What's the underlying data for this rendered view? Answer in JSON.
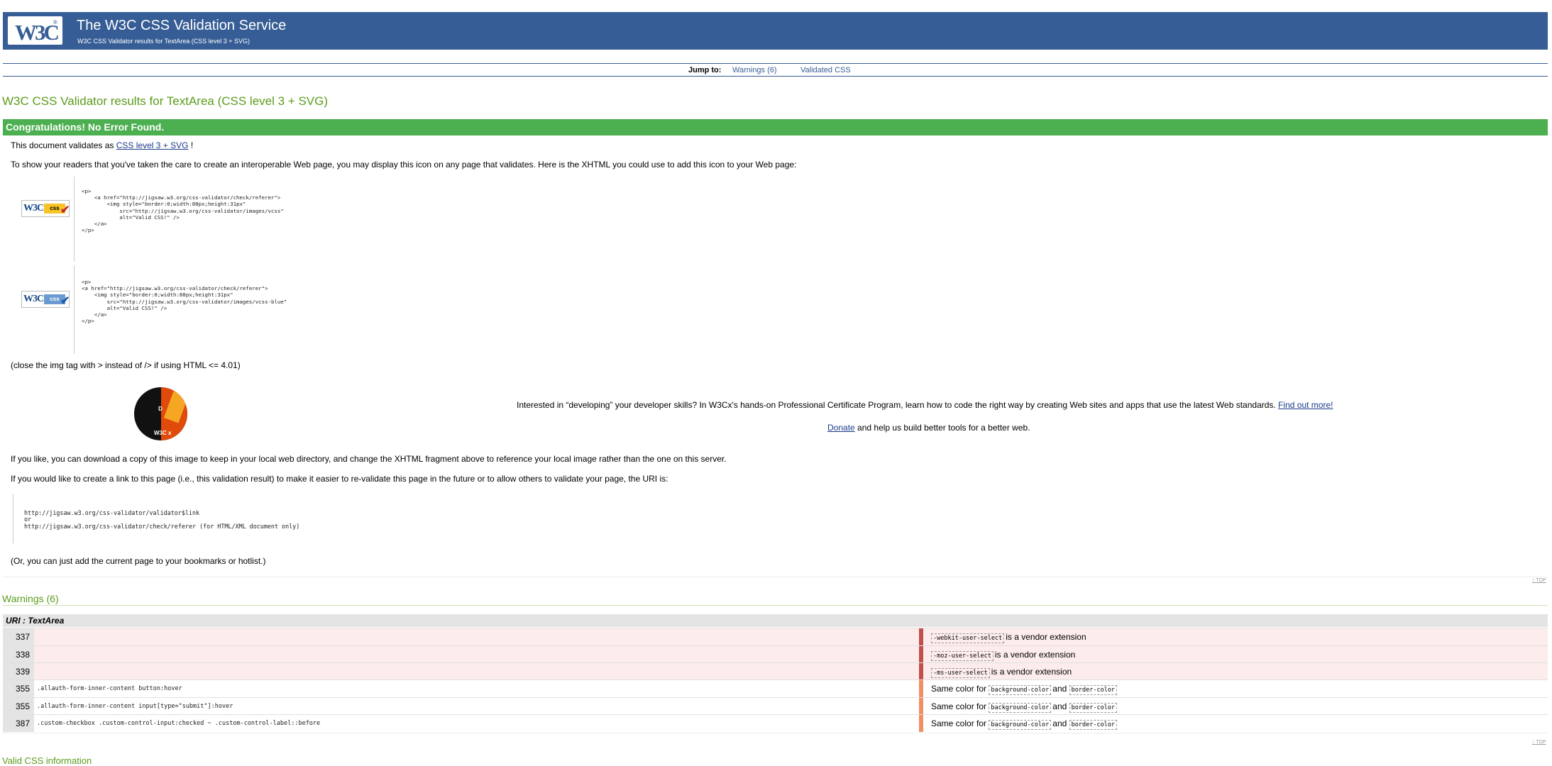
{
  "banner": {
    "logo": "W3C",
    "title": "The W3C CSS Validation Service",
    "subtitle": "W3C CSS Validator results for TextArea (CSS level 3 + SVG)"
  },
  "jump": {
    "label": "Jump to:",
    "links": [
      "Warnings (6)",
      "Validated CSS"
    ]
  },
  "results_title": "W3C CSS Validator results for TextArea (CSS level 3 + SVG)",
  "congrats": "Congratulations! No Error Found.",
  "validates": {
    "prefix": "This document validates as",
    "link": "CSS level 3 + SVG",
    "suffix": "!"
  },
  "show_icon_text": "To show your readers that you've taken the care to create an interoperable Web page, you may display this icon on any page that validates. Here is the XHTML you could use to add this icon to your Web page:",
  "badges": {
    "gold": {
      "w3": "W3C",
      "tag": "css",
      "mark": "✔"
    },
    "blue": {
      "w3": "W3C",
      "tag": "css",
      "mark": "✔"
    }
  },
  "code_snippet_1": "<p>\n    <a href=\"http://jigsaw.w3.org/css-validator/check/referer\">\n        <img style=\"border:0;width:88px;height:31px\"\n            src=\"http://jigsaw.w3.org/css-validator/images/vcss\"\n            alt=\"Valid CSS!\" />\n    </a>\n</p>",
  "code_snippet_2": "<p>\n<a href=\"http://jigsaw.w3.org/css-validator/check/referer\">\n    <img style=\"border:0;width:88px;height:31px\"\n        src=\"http://jigsaw.w3.org/css-validator/images/vcss-blue\"\n        alt=\"Valid CSS!\" />\n    </a>\n</p>",
  "close_tag_note": "(close the img tag with > instead of /> if using HTML <= 4.01)",
  "emblem": {
    "letter": "D",
    "brand": "W3C x"
  },
  "promo": {
    "text": "Interested in “developing” your developer skills? In W3Cx's hands-on Professional Certificate Program, learn how to code the right way by creating Web sites and apps that use the latest Web standards.",
    "link": "Find out more!"
  },
  "donate": {
    "link": "Donate",
    "text": "and help us build better tools for a better web."
  },
  "download_text": "If you like, you can download a copy of this image to keep in your local web directory, and change the XHTML fragment above to reference your local image rather than the one on this server.",
  "link_text": "If you would like to create a link to this page (i.e., this validation result) to make it easier to re-validate this page in the future or to allow others to validate your page, the URI is:",
  "uris": {
    "line1": "http://jigsaw.w3.org/css-validator/validator$link",
    "or": "or",
    "line2": "http://jigsaw.w3.org/css-validator/check/referer (for HTML/XML document only)"
  },
  "bookmark_text": "(Or, you can just add the current page to your bookmarks or hotlist.)",
  "top_link": "↑ TOP",
  "warnings": {
    "title": "Warnings (6)",
    "uri_label": "URI : TextArea",
    "rows": [
      {
        "line": "337",
        "selector": "",
        "kind": "vendor",
        "code1": "-webkit-user-select",
        "mid": "is a vendor extension",
        "code2": "",
        "after": ""
      },
      {
        "line": "338",
        "selector": "",
        "kind": "vendor",
        "code1": "-moz-user-select",
        "mid": "is a vendor extension",
        "code2": "",
        "after": ""
      },
      {
        "line": "339",
        "selector": "",
        "kind": "vendor",
        "code1": "-ms-user-select",
        "mid": "is a vendor extension",
        "code2": "",
        "after": ""
      },
      {
        "line": "355",
        "selector": ".allauth-form-inner-content button:hover",
        "kind": "same",
        "pre": "Same color for",
        "code1": "background-color",
        "mid": "and",
        "code2": "border-color"
      },
      {
        "line": "355",
        "selector": ".allauth-form-inner-content input[type=\"submit\"]:hover",
        "kind": "same",
        "pre": "Same color for",
        "code1": "background-color",
        "mid": "and",
        "code2": "border-color"
      },
      {
        "line": "387",
        "selector": ".custom-checkbox .custom-control-input:checked ~ .custom-control-label::before",
        "kind": "same",
        "pre": "Same color for",
        "code1": "background-color",
        "mid": "and",
        "code2": "border-color"
      }
    ]
  },
  "valid_css_title": "Valid CSS information",
  "colors": {
    "banner": "#365d95",
    "success": "#4caf50",
    "heading": "#5c9c1c",
    "vendor_stripe": "#c0504d",
    "same_color_stripe": "#ef8f63"
  }
}
